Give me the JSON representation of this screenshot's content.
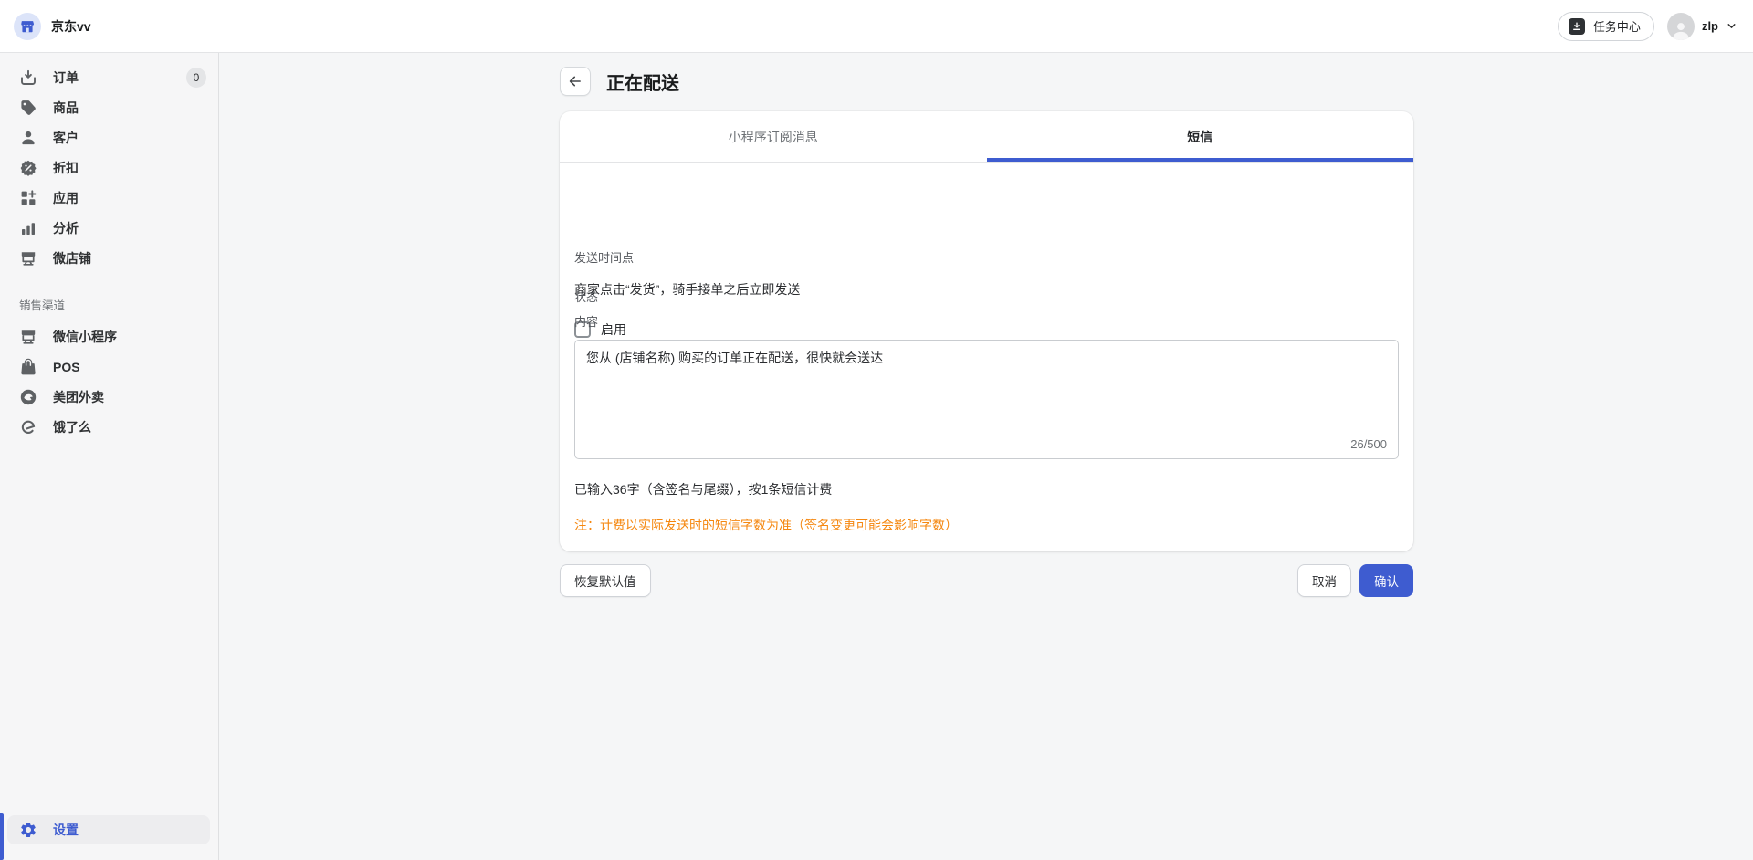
{
  "topbar": {
    "brand": "京东vv",
    "task_center_label": "任务中心",
    "user_name": "zlp"
  },
  "sidebar": {
    "items": [
      {
        "label": "订单",
        "icon": "orders-icon",
        "badge": "0"
      },
      {
        "label": "商品",
        "icon": "products-icon"
      },
      {
        "label": "客户",
        "icon": "customers-icon"
      },
      {
        "label": "折扣",
        "icon": "discounts-icon"
      },
      {
        "label": "应用",
        "icon": "apps-icon"
      },
      {
        "label": "分析",
        "icon": "analytics-icon"
      },
      {
        "label": "微店铺",
        "icon": "microstore-icon"
      }
    ],
    "channels_header": "销售渠道",
    "channels": [
      {
        "label": "微信小程序",
        "icon": "wechat-miniprogram-icon"
      },
      {
        "label": "POS",
        "icon": "pos-bag-icon"
      },
      {
        "label": "美团外卖",
        "icon": "meituan-icon"
      },
      {
        "label": "饿了么",
        "icon": "eleme-icon"
      }
    ],
    "settings_label": "设置"
  },
  "page": {
    "title": "正在配送",
    "tabs": [
      {
        "label": "小程序订阅消息",
        "active": false
      },
      {
        "label": "短信",
        "active": true
      }
    ],
    "form": {
      "status_label": "状态",
      "enable_label": "启用",
      "enable_checked": false,
      "send_time_label": "发送时间点",
      "send_time_value": "商家点击“发货”，骑手接单之后立即发送",
      "content_label": "内容",
      "content_value": "您从 (店铺名称) 购买的订单正在配送，很快就会送达",
      "char_counter": "26/500",
      "input_summary": "已输入36字（含签名与尾缀），按1条短信计费",
      "billing_note": "注：计费以实际发送时的短信字数为准（签名变更可能会影响字数）"
    },
    "actions": {
      "restore_default": "恢复默认值",
      "cancel": "取消",
      "confirm": "确认"
    }
  },
  "colors": {
    "accent": "#3e5cd0",
    "note_orange": "#f5870f"
  }
}
